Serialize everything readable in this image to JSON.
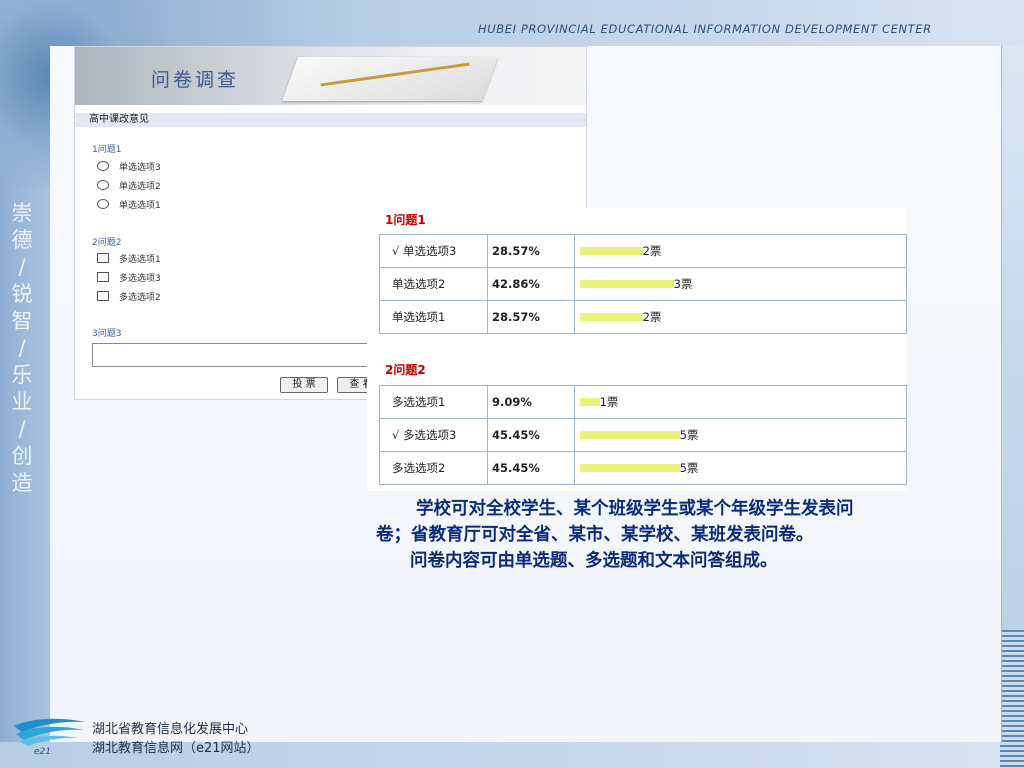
{
  "header": {
    "title": "HUBEI  PROVINCIAL  EDUCATIONAL  INFORMATION  DEVELOPMENT  CENTER"
  },
  "slogan": [
    "崇",
    "德",
    "/",
    "锐",
    "智",
    "/",
    "乐",
    "业",
    "/",
    "创",
    "造"
  ],
  "survey": {
    "banner_title": "问卷调查",
    "heading": "高中课改意见",
    "q1": {
      "label": "1问题1",
      "options": [
        "单选选项3",
        "单选选项2",
        "单选选项1"
      ]
    },
    "q2": {
      "label": "2问题2",
      "options": [
        "多选选项1",
        "多选选项3",
        "多选选项2"
      ]
    },
    "q3": {
      "label": "3问题3"
    },
    "vote_button": "投 票",
    "view_button": "查 看"
  },
  "results": {
    "q1": {
      "title": "1问题1",
      "rows": [
        {
          "label": "√  单选选项3",
          "percent": "28.57%",
          "votes": "2票",
          "fraction": 0.2857
        },
        {
          "label": "单选选项2",
          "percent": "42.86%",
          "votes": "3票",
          "fraction": 0.4286
        },
        {
          "label": "单选选项1",
          "percent": "28.57%",
          "votes": "2票",
          "fraction": 0.2857
        }
      ]
    },
    "q2": {
      "title": "2问题2",
      "rows": [
        {
          "label": "多选选项1",
          "percent": "9.09%",
          "votes": "1票",
          "fraction": 0.0909
        },
        {
          "label": "√  多选选项3",
          "percent": "45.45%",
          "votes": "5票",
          "fraction": 0.4545
        },
        {
          "label": "多选选项2",
          "percent": "45.45%",
          "votes": "5票",
          "fraction": 0.4545
        }
      ]
    }
  },
  "description": {
    "line1": "学校可对全校学生、某个班级学生或某个年级学生发表问",
    "line2": "卷；省教育厅可对全省、某市、某学校、某班发表问卷。",
    "line3": "问卷内容可由单选题、多选题和文本问答组成。"
  },
  "footer": {
    "line1": "湖北省教育信息化发展中心",
    "line2": "湖北教育信息网（e21网站）",
    "logo_text": "e21"
  }
}
